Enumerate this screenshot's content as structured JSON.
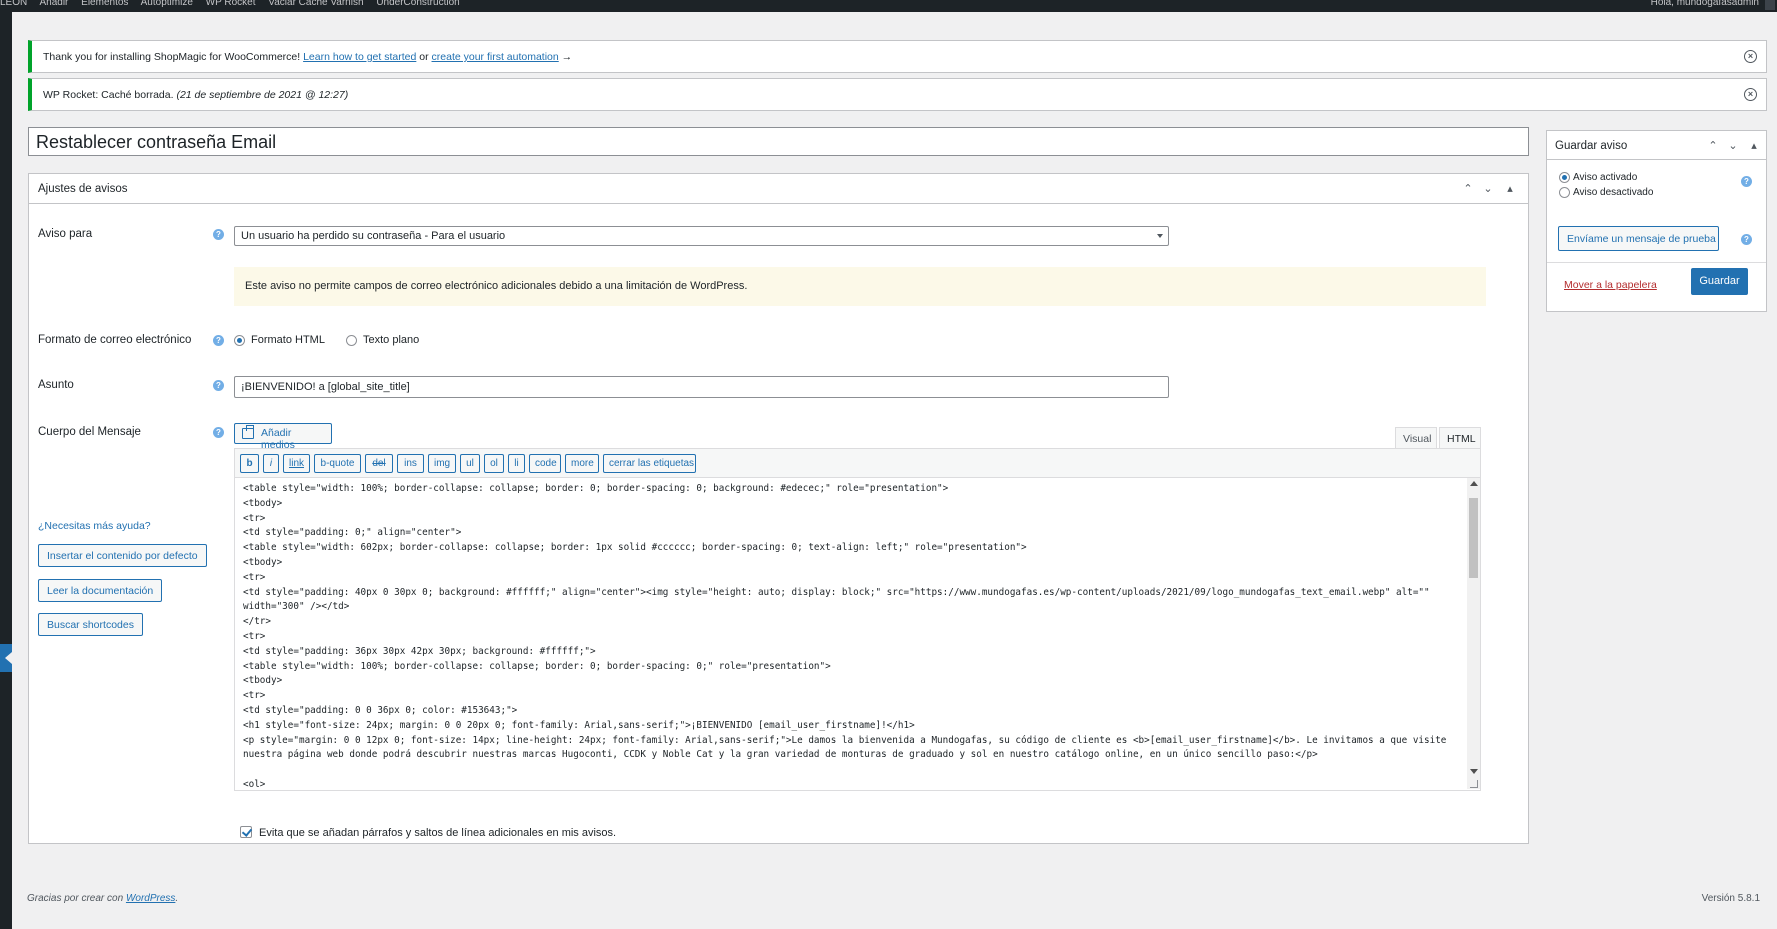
{
  "admin_bar": {
    "items": [
      "LEON",
      "Añadir",
      "Elementos",
      "Autoptimize",
      "WP Rocket",
      "Vaciar Caché Varnish",
      "UnderConstruction"
    ],
    "greeting": "Hola, mundogafasadmin"
  },
  "notices": {
    "shopmagic": {
      "text_before": "Thank you for installing ShopMagic for WooCommerce! ",
      "link1": "Learn how to get started",
      "text_middle": " or ",
      "link2": "create your first automation",
      "text_after": " →"
    },
    "rocket": {
      "text": "WP Rocket: Caché borrada. ",
      "date": "(21 de septiembre de 2021 @ 12:27)"
    }
  },
  "title": "Restablecer contraseña Email",
  "settings_box": {
    "heading": "Ajustes de avisos",
    "aviso_para_label": "Aviso para",
    "aviso_para_value": "Un usuario ha perdido su contraseña - Para el usuario",
    "warning": "Este aviso no permite campos de correo electrónico adicionales debido a una limitación de WordPress.",
    "format_label": "Formato de correo electrónico",
    "format_html": "Formato HTML",
    "format_plain": "Texto plano",
    "subject_label": "Asunto",
    "subject_value": "¡BIENVENIDO! a [global_site_title]",
    "body_label": "Cuerpo del Mensaje",
    "add_media": "Añadir medios",
    "tab_visual": "Visual",
    "tab_html": "HTML",
    "toolbar": [
      "b",
      "i",
      "link",
      "b-quote",
      "del",
      "ins",
      "img",
      "ul",
      "ol",
      "li",
      "code",
      "more",
      "cerrar las etiquetas"
    ],
    "code": "<table style=\"width: 100%; border-collapse: collapse; border: 0; border-spacing: 0; background: #edecec;\" role=\"presentation\">\n<tbody>\n<tr>\n<td style=\"padding: 0;\" align=\"center\">\n<table style=\"width: 602px; border-collapse: collapse; border: 1px solid #cccccc; border-spacing: 0; text-align: left;\" role=\"presentation\">\n<tbody>\n<tr>\n<td style=\"padding: 40px 0 30px 0; background: #ffffff;\" align=\"center\"><img style=\"height: auto; display: block;\" src=\"https://www.mundogafas.es/wp-content/uploads/2021/09/logo_mundogafas_text_email.webp\" alt=\"\"\nwidth=\"300\" /></td>\n</tr>\n<tr>\n<td style=\"padding: 36px 30px 42px 30px; background: #ffffff;\">\n<table style=\"width: 100%; border-collapse: collapse; border: 0; border-spacing: 0;\" role=\"presentation\">\n<tbody>\n<tr>\n<td style=\"padding: 0 0 36px 0; color: #153643;\">\n<h1 style=\"font-size: 24px; margin: 0 0 20px 0; font-family: Arial,sans-serif;\">¡BIENVENIDO [email_user_firstname]!</h1>\n<p style=\"margin: 0 0 12px 0; font-size: 14px; line-height: 24px; font-family: Arial,sans-serif;\">Le damos la bienvenida a Mundogafas, su código de cliente es <b>[email_user_firstname]</b>. Le invitamos a que visite\nnuestra página web donde podrá descubrir nuestras marcas Hugoconti, CCDK y Noble Cat y la gran variedad de monturas de graduado y sol en nuestro catálogo online, en un único sencillo paso:</p>\n\n<ol>",
    "autop_label": "Evita que se añadan párrafos y saltos de línea adicionales en mis avisos.",
    "help_link": "¿Necesitas más ayuda?",
    "btn_insert_default": "Insertar el contenido por defecto",
    "btn_docs": "Leer la documentación",
    "btn_shortcodes": "Buscar shortcodes"
  },
  "side_box": {
    "heading": "Guardar aviso",
    "active_label": "Aviso activado",
    "inactive_label": "Aviso desactivado",
    "test_button": "Envíame un mensaje de prueba",
    "trash_link": "Mover a la papelera",
    "save_button": "Guardar"
  },
  "footer": {
    "thanks_text": "Gracias por crear con ",
    "wp_link": "WordPress",
    "thanks_end": ".",
    "version": "Versión 5.8.1"
  }
}
